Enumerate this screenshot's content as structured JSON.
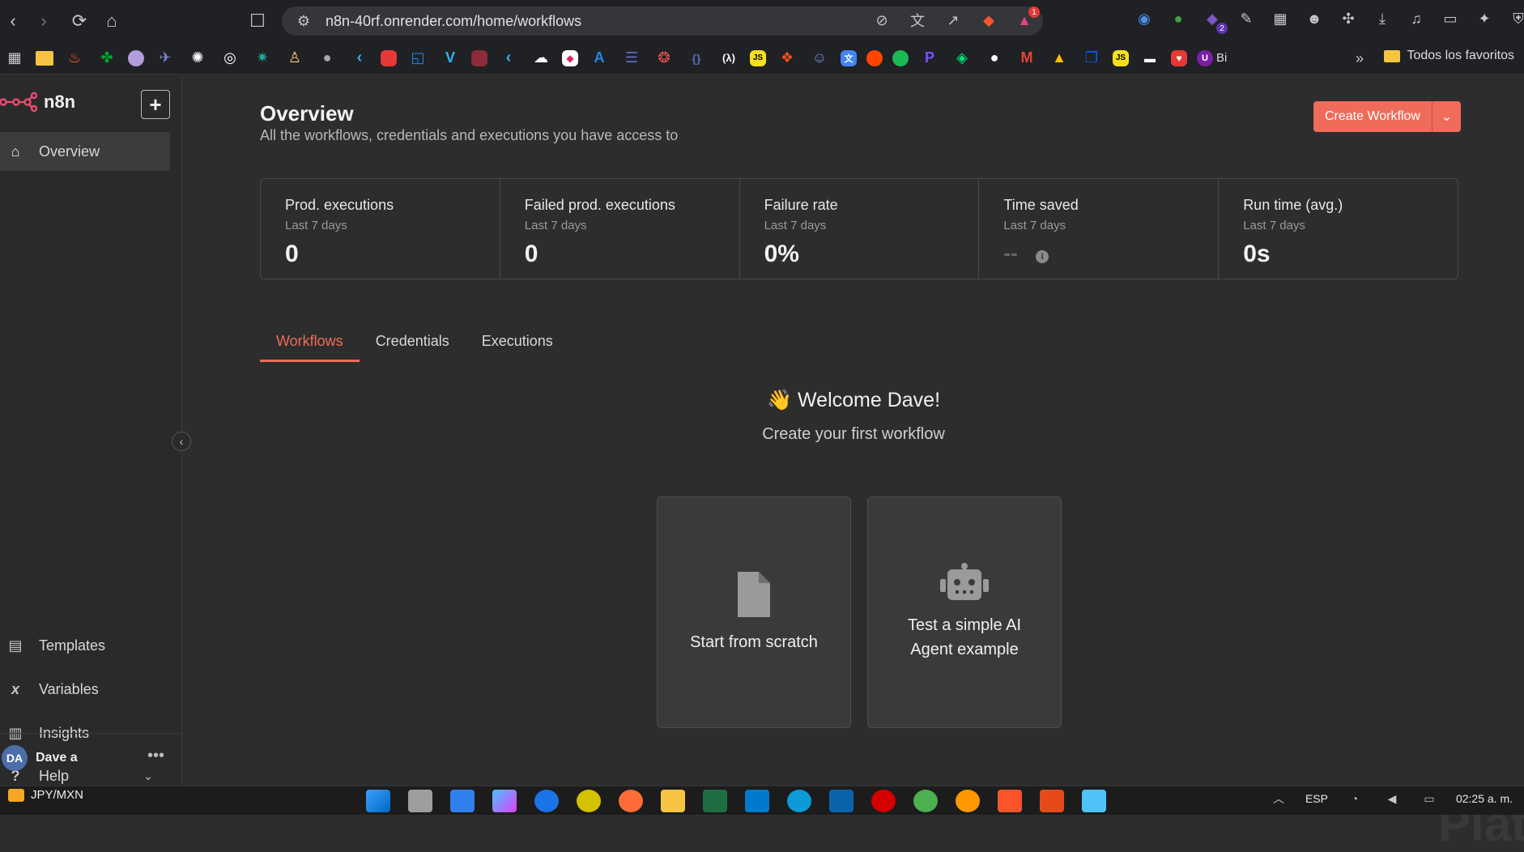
{
  "browser": {
    "url": "n8n-40rf.onrender.com/home/workflows",
    "notification_count": "1",
    "ext_badge": "2",
    "bookmarks_folder": "Todos los favoritos",
    "bookmark_last": "Bi"
  },
  "sidebar": {
    "logo": "n8n",
    "items_top": [
      {
        "label": "Overview"
      }
    ],
    "items_bottom": [
      {
        "label": "Templates"
      },
      {
        "label": "Variables"
      },
      {
        "label": "Insights"
      },
      {
        "label": "Help"
      }
    ],
    "user": {
      "initials": "DA",
      "name": "Dave a"
    }
  },
  "main": {
    "title": "Overview",
    "subtitle": "All the workflows, credentials and executions you have access to",
    "create_button": "Create Workflow",
    "stats": [
      {
        "label": "Prod. executions",
        "period": "Last 7 days",
        "value": "0"
      },
      {
        "label": "Failed prod. executions",
        "period": "Last 7 days",
        "value": "0"
      },
      {
        "label": "Failure rate",
        "period": "Last 7 days",
        "value": "0%"
      },
      {
        "label": "Time saved",
        "period": "Last 7 days",
        "value": "--"
      },
      {
        "label": "Run time (avg.)",
        "period": "Last 7 days",
        "value": "0s"
      }
    ],
    "tabs": [
      "Workflows",
      "Credentials",
      "Executions"
    ],
    "welcome_title": "👋 Welcome Dave!",
    "welcome_sub": "Create your first workflow",
    "cards": [
      {
        "label": "Start from scratch",
        "icon": "file-icon"
      },
      {
        "label": "Test a simple AI Agent example",
        "icon": "robot-icon"
      }
    ]
  },
  "taskbar": {
    "ticker": "JPY/MXN",
    "lang": "ESP",
    "time": "02:25 a. m."
  },
  "watermark": "Platzi",
  "colors": {
    "accent": "#ef6b5a",
    "bg": "#2d2d2d"
  }
}
